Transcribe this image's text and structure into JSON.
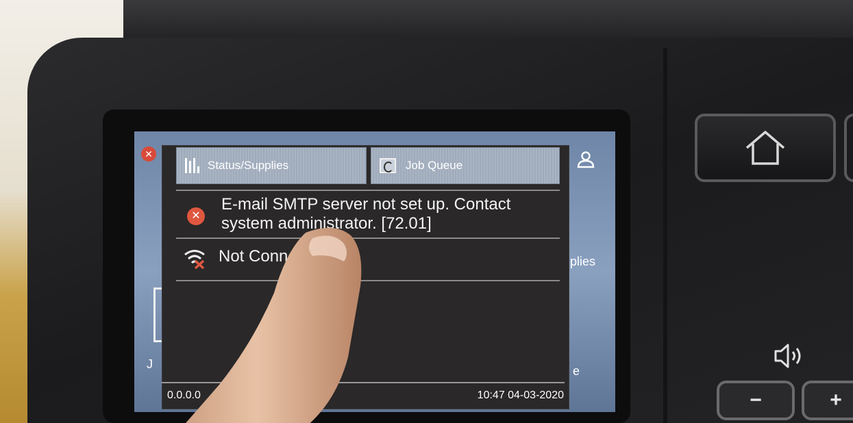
{
  "tabs": {
    "status_supplies": "Status/Supplies",
    "job_queue": "Job Queue"
  },
  "messages": [
    {
      "icon": "error-icon",
      "text": "E-mail SMTP server not set up. Contact system administrator. [72.01]"
    },
    {
      "icon": "wifi-disconnected-icon",
      "text": "Not Connected"
    }
  ],
  "footer": {
    "ip_address": "0.0.0.0",
    "datetime": "10:47 04-03-2020"
  },
  "background_screen": {
    "left_label": "J",
    "right_label": "plies",
    "right_label_2": "e"
  },
  "hardware": {
    "minus_label": "−",
    "plus_label": "+"
  },
  "colors": {
    "error": "#e0573f",
    "tab": "#a9b4c3",
    "panel": "#2a2828"
  }
}
